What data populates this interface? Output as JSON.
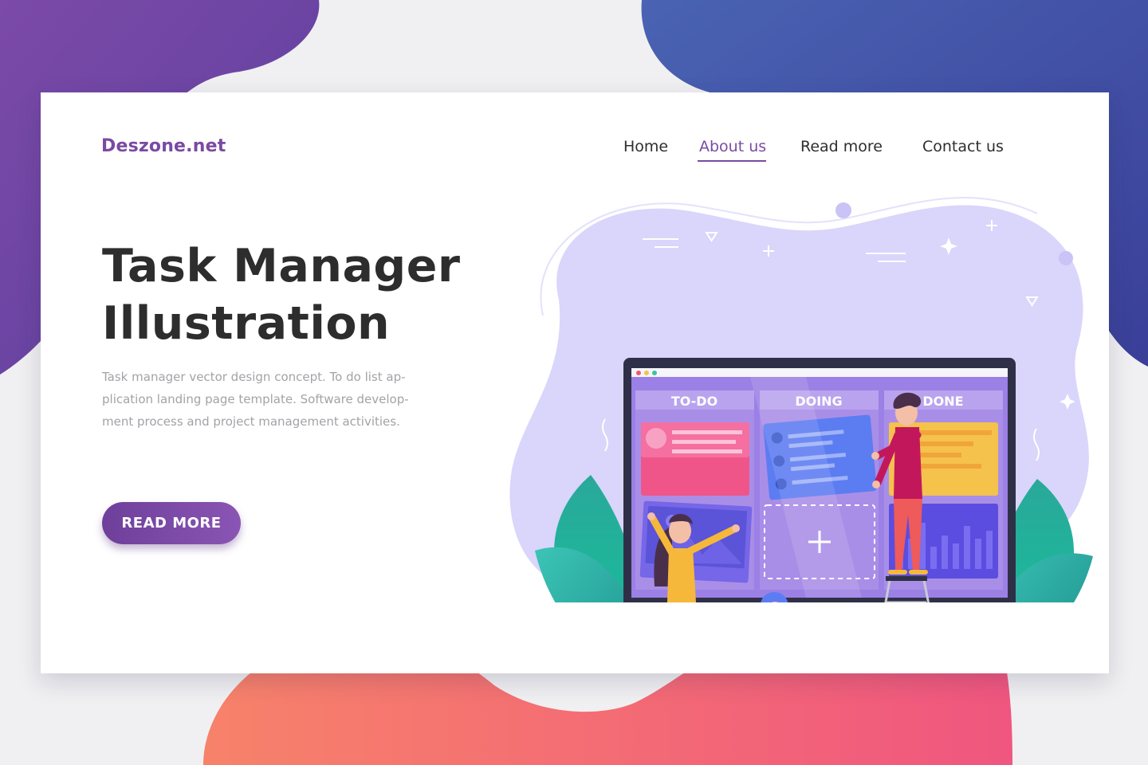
{
  "brand": {
    "name": "Deszone.net"
  },
  "nav": {
    "items": [
      {
        "label": "Home",
        "active": false
      },
      {
        "label": "About us",
        "active": true
      },
      {
        "label": "Read more",
        "active": false
      },
      {
        "label": "Contact us",
        "active": false
      }
    ]
  },
  "hero": {
    "title_lines": [
      "Task Manager",
      "Illustration"
    ],
    "description_lines": [
      "Task manager vector design concept. To do list ap-",
      "plication landing page template. Software develop-",
      "ment process and project management activities."
    ],
    "cta_label": "READ MORE"
  },
  "illustration": {
    "columns": [
      "TO-DO",
      "DOING",
      "DONE"
    ],
    "icons": [
      "browser-dots-icon",
      "plus-icon",
      "sparkle-icon",
      "triangle-icon"
    ]
  },
  "colors": {
    "brand_purple": "#7a4aa3",
    "board_purple": "#a98ee8",
    "todo_pink": "#f0558a",
    "doing_blue": "#5c7cf2",
    "done_yellow": "#f5c24c",
    "leaf_teal": "#1fb39c"
  }
}
